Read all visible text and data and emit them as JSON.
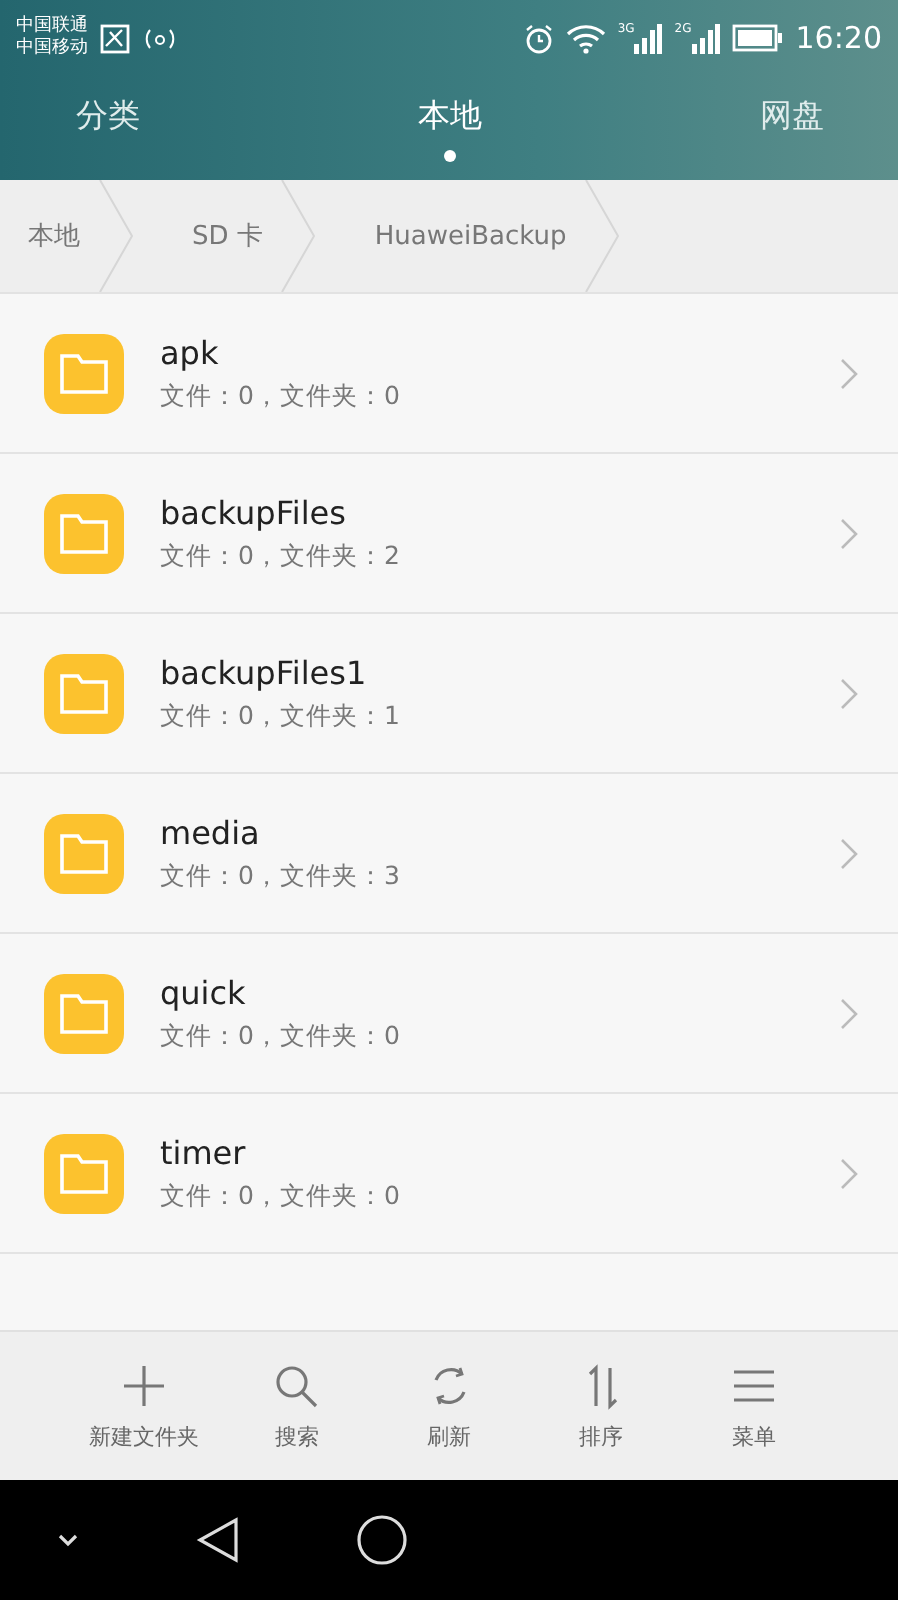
{
  "status_bar": {
    "carriers": [
      "中国联通",
      "中国移动"
    ],
    "networks": [
      "3G",
      "2G"
    ],
    "time": "16:20"
  },
  "tabs": [
    {
      "label": "分类",
      "selected": false
    },
    {
      "label": "本地",
      "selected": true
    },
    {
      "label": "网盘",
      "selected": false
    }
  ],
  "breadcrumb": [
    "本地",
    "SD 卡",
    "HuaweiBackup"
  ],
  "folders": [
    {
      "name": "apk",
      "detail": "文件：0，文件夹：0"
    },
    {
      "name": "backupFiles",
      "detail": "文件：0，文件夹：2"
    },
    {
      "name": "backupFiles1",
      "detail": "文件：0，文件夹：1"
    },
    {
      "name": "media",
      "detail": "文件：0，文件夹：3"
    },
    {
      "name": "quick",
      "detail": "文件：0，文件夹：0"
    },
    {
      "name": "timer",
      "detail": "文件：0，文件夹：0"
    }
  ],
  "toolbar": [
    {
      "kind": "add",
      "label": "新建文件夹"
    },
    {
      "kind": "search",
      "label": "搜索"
    },
    {
      "kind": "refresh",
      "label": "刷新"
    },
    {
      "kind": "sort",
      "label": "排序"
    },
    {
      "kind": "menu",
      "label": "菜单"
    }
  ]
}
